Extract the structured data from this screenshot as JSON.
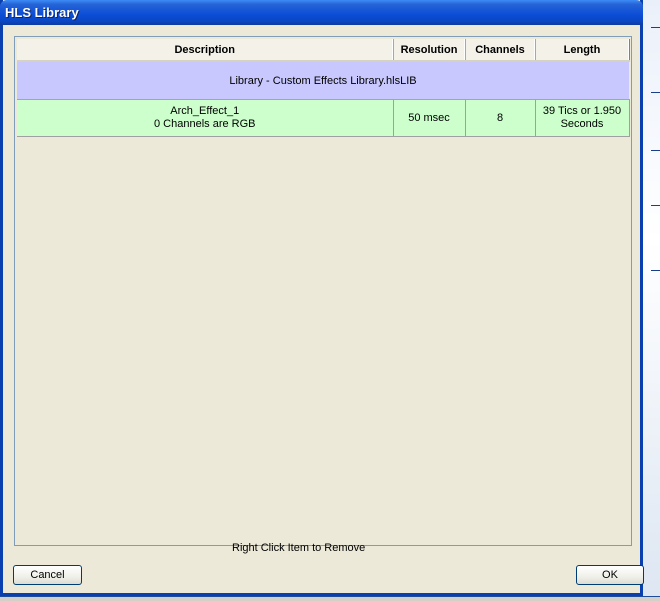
{
  "window": {
    "title": "HLS Library"
  },
  "table": {
    "columns": [
      "Description",
      "Resolution",
      "Channels",
      "Length"
    ],
    "library_row": "Library - Custom Effects Library.hlsLIB",
    "effects": [
      {
        "name": "Arch_Effect_1",
        "channels_note": "0 Channels are RGB",
        "resolution": "50 msec",
        "channels": "8",
        "length": "39 Tics or 1.950 Seconds"
      }
    ]
  },
  "footer": {
    "cancel_label": "Cancel",
    "hint": "Right Click Item to Remove",
    "ok_label": "OK"
  }
}
